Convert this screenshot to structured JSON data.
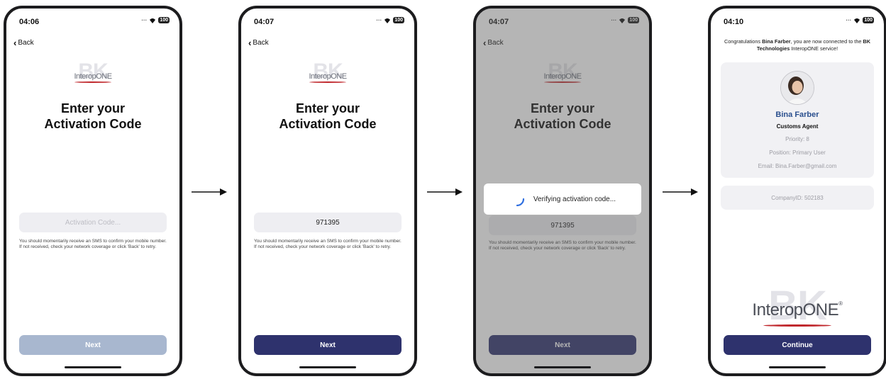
{
  "screens": [
    {
      "status_time": "04:06",
      "battery": "100",
      "back_label": "Back",
      "logo_text": "InteropONE",
      "title_line1": "Enter your",
      "title_line2": "Activation Code",
      "code_placeholder": "Activation Code...",
      "hint": "You should momentarily receive an SMS to confirm your mobile number. If not received, check your network coverage or click 'Back' to retry.",
      "next_label": "Next"
    },
    {
      "status_time": "04:07",
      "battery": "100",
      "back_label": "Back",
      "logo_text": "InteropONE",
      "title_line1": "Enter your",
      "title_line2": "Activation Code",
      "code_value": "971395",
      "hint": "You should momentarily receive an SMS to confirm your mobile number. If not received, check your network coverage or click 'Back' to retry.",
      "next_label": "Next"
    },
    {
      "status_time": "04:07",
      "battery": "100",
      "back_label": "Back",
      "logo_text": "InteropONE",
      "title_line1": "Enter your",
      "title_line2": "Activation Code",
      "code_value": "971395",
      "verifying_text": "Verifying activation code...",
      "hint": "You should momentarily receive an SMS to confirm your mobile number. If not received, check your network coverage or click 'Back' to retry.",
      "next_label": "Next"
    },
    {
      "status_time": "04:10",
      "battery": "100",
      "congrats_pre": "Congratulations ",
      "user_name": "Bina  Farber",
      "congrats_mid": ", you are now connected to the ",
      "company_name": "BK Technologies",
      "congrats_post": " InteropONE service!",
      "profile_name": "Bina Farber",
      "role": "Customs Agent",
      "priority": "Priority: 8",
      "position": "Position: Primary User",
      "email": "Email: Bina.Farber@gmail.com",
      "company_id": "CompanyID: 502183",
      "logo_text": "InteropONE",
      "continue_label": "Continue"
    }
  ],
  "colors": {
    "button_disabled": "#a8b7cf",
    "button_active": "#2e326d",
    "name_blue": "#2a4f8e",
    "logo_red": "#c0282d",
    "spinner_blue": "#2f6fe0"
  }
}
